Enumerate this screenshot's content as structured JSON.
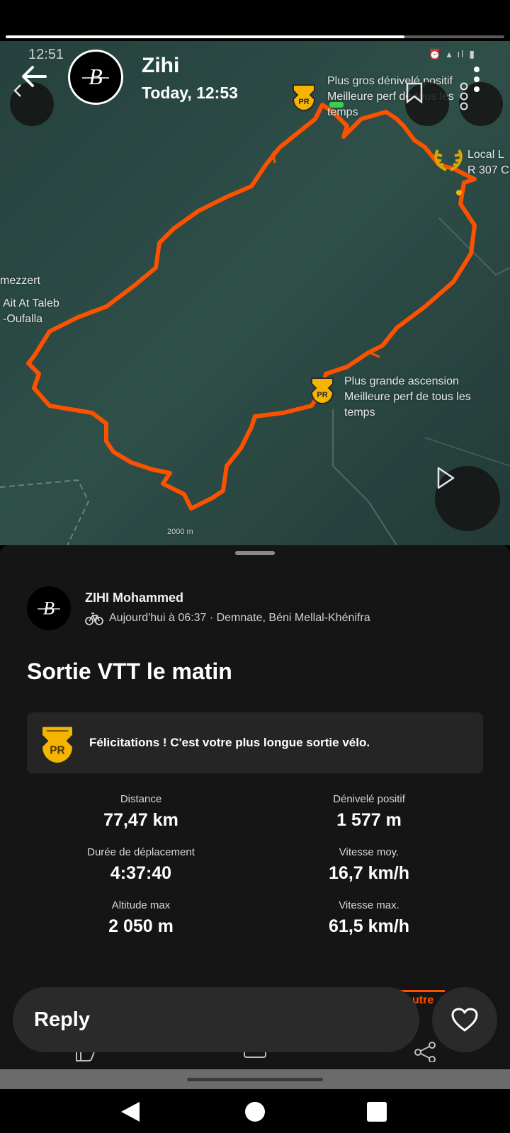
{
  "story": {
    "progress": 0.8,
    "user_name": "Zihi",
    "timestamp": "Today, 12:53"
  },
  "map": {
    "inner_status_time": "12:51",
    "labels": {
      "top_pr": "Plus gros dénivelé positif\nMeilleure perf de tous les\ntemps",
      "local_legend": "Local L\nR 307 C",
      "town1": "mezzert",
      "town2": "Ait At Taleb\n-Oufalla",
      "mid_pr": "Plus grande ascension\nMeilleure perf de tous les\ntemps",
      "scale": "2000 m"
    },
    "route_color": "#fc5200",
    "pr_badge_color": "#f4b400"
  },
  "activity": {
    "athlete": "ZIHI Mohammed",
    "meta": "Aujourd'hui à 06:37 · Demnate, Béni Mellal-Khénifra",
    "title": "Sortie VTT le matin",
    "pr_badge": "PR",
    "congrats": "Félicitations ! C'est votre plus longue sortie vélo.",
    "stats": [
      {
        "label": "Distance",
        "value": "77,47 km"
      },
      {
        "label": "Dénivelé positif",
        "value": "1 577 m"
      },
      {
        "label": "Durée de déplacement",
        "value": "4:37:40"
      },
      {
        "label": "Vitesse moy.",
        "value": "16,7 km/h"
      },
      {
        "label": "Altitude max",
        "value": "2 050 m"
      },
      {
        "label": "Vitesse max.",
        "value": "61,5 km/h"
      }
    ],
    "tab_text": "utre"
  },
  "reply": {
    "label": "Reply"
  },
  "icons": {
    "back": "arrow-left-icon",
    "more": "more-vertical-icon",
    "bookmark": "bookmark-icon",
    "play": "play-icon",
    "heart": "heart-icon",
    "bike": "bike-icon"
  }
}
